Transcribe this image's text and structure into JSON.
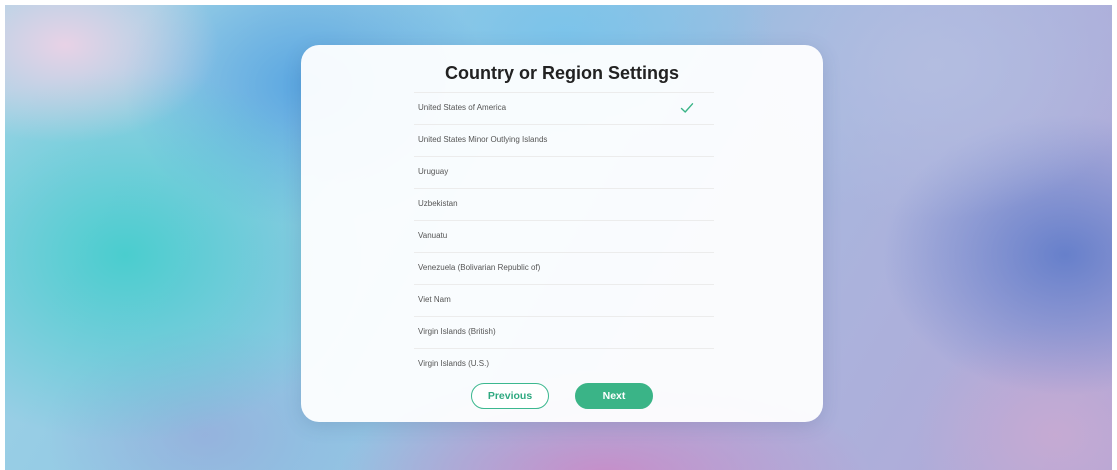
{
  "dialog": {
    "title": "Country or Region Settings",
    "items": [
      {
        "label": "United States of America",
        "selected": true
      },
      {
        "label": "United States Minor Outlying Islands",
        "selected": false
      },
      {
        "label": "Uruguay",
        "selected": false
      },
      {
        "label": "Uzbekistan",
        "selected": false
      },
      {
        "label": "Vanuatu",
        "selected": false
      },
      {
        "label": "Venezuela (Bolivarian Republic of)",
        "selected": false
      },
      {
        "label": "Viet Nam",
        "selected": false
      },
      {
        "label": "Virgin Islands (British)",
        "selected": false
      },
      {
        "label": "Virgin Islands (U.S.)",
        "selected": false
      }
    ],
    "previous_label": "Previous",
    "next_label": "Next"
  },
  "icons": {
    "selected": "checkmark-icon"
  },
  "colors": {
    "accent": "#3ab487",
    "title_text": "#222222",
    "item_text": "#555555"
  }
}
